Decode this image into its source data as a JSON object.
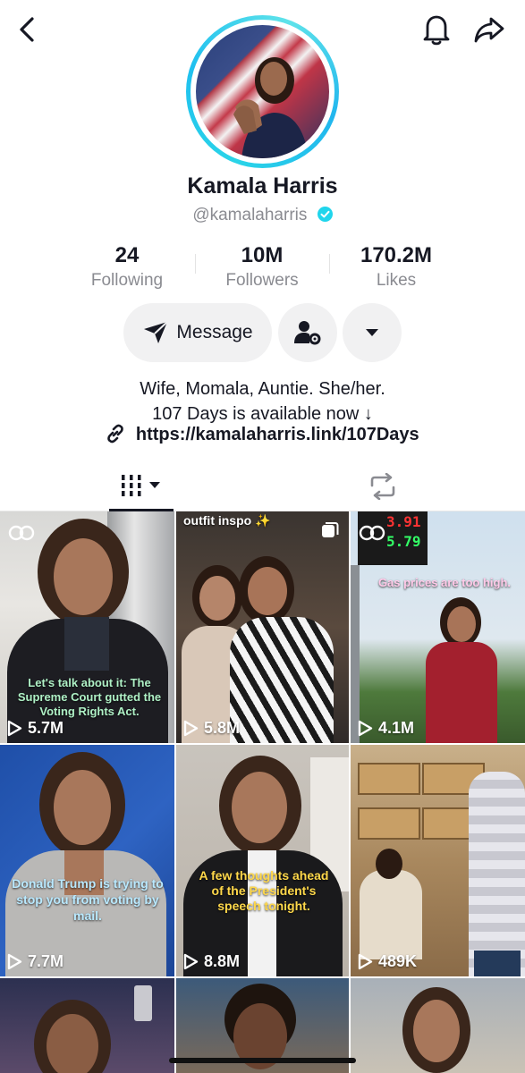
{
  "profile": {
    "name": "Kamala Harris",
    "handle": "@kamalaharris",
    "verified": true,
    "stats": [
      {
        "value": "24",
        "label": "Following"
      },
      {
        "value": "10M",
        "label": "Followers"
      },
      {
        "value": "170.2M",
        "label": "Likes"
      }
    ],
    "bio_line1": "Wife, Momala, Auntie. She/her.",
    "bio_line2": "107 Days is available now ↓",
    "link": "https://kamalaharris.link/107Days"
  },
  "actions": {
    "message_label": "Message"
  },
  "videos": [
    {
      "views": "5.7M",
      "caption": "Let's talk about it: The Supreme Court gutted the Voting Rights Act."
    },
    {
      "views": "5.8M",
      "caption": "outfit inspo ✨"
    },
    {
      "views": "4.1M",
      "caption": "Gas prices are too high.",
      "sign_top": "3.91",
      "sign_bottom": "5.79"
    },
    {
      "views": "7.7M",
      "caption": "Donald Trump is trying to stop you from voting by mail."
    },
    {
      "views": "8.8M",
      "caption": "A few thoughts ahead of the President's speech tonight."
    },
    {
      "views": "489K",
      "caption": ""
    }
  ],
  "colors": {
    "ring": "#20d5ec",
    "text": "#161823",
    "muted": "#8a8b91",
    "button_bg": "#f1f1f2"
  }
}
